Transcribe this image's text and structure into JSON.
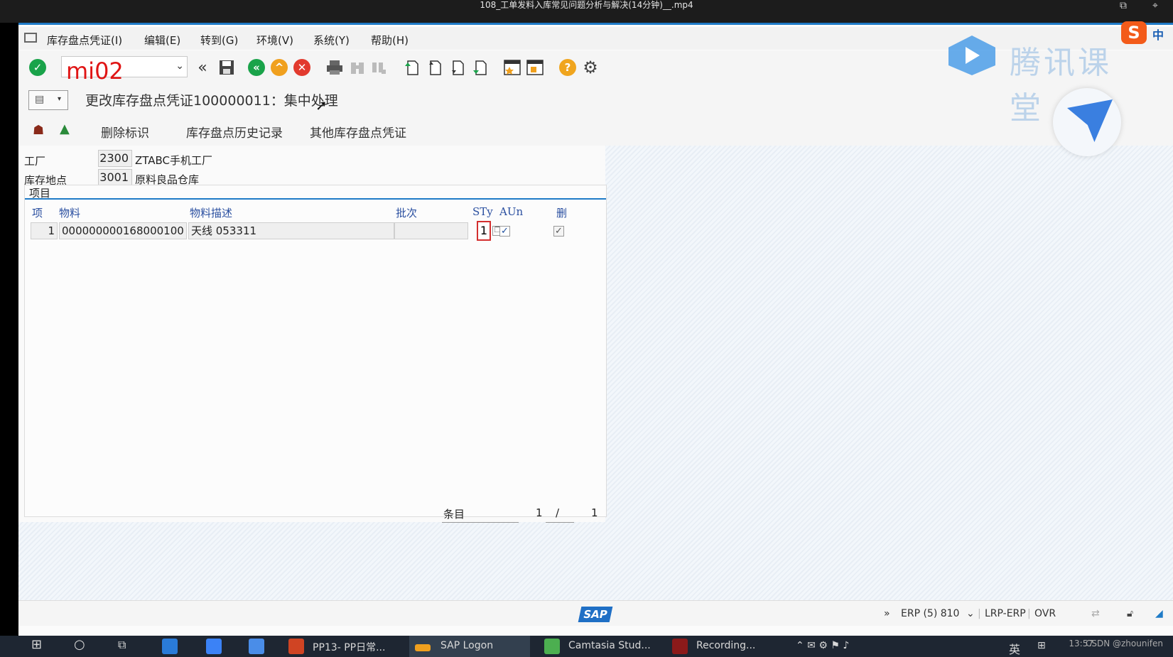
{
  "video": {
    "title": "108_工单发料入库常见问题分析与解决(14分钟)__.mp4"
  },
  "menu": [
    "库存盘点凭证(I)",
    "编辑(E)",
    "转到(G)",
    "环境(V)",
    "系统(Y)",
    "帮助(H)"
  ],
  "command": {
    "value": "mi02"
  },
  "screen": {
    "title": "更改库存盘点凭证100000011：集中处理"
  },
  "app_toolbar": {
    "delete_flag": "删除标识",
    "history": "库存盘点历史记录",
    "other": "其他库存盘点凭证"
  },
  "header": {
    "plant_label": "工厂",
    "plant_value": "2300",
    "plant_desc": "ZTABC手机工厂",
    "sloc_label": "库存地点",
    "sloc_value": "3001",
    "sloc_desc": "原料良品仓库"
  },
  "table": {
    "title": "项目",
    "columns": {
      "item": "项",
      "material": "物料",
      "desc": "物料描述",
      "batch": "批次",
      "sty": "STy",
      "aun": "AUn",
      "del": "删"
    },
    "rows": [
      {
        "item": "1",
        "material": "000000000168000100",
        "desc": "天线 053311",
        "batch": "",
        "sty": "1",
        "aun_checked": true,
        "del_checked": true
      }
    ],
    "footer": {
      "label": "条目",
      "current": "1",
      "sep": "/",
      "total": "1"
    }
  },
  "status": {
    "arrows": "»",
    "system": "ERP (5) 810",
    "server": "LRP-ERP",
    "mode": "OVR"
  },
  "watermark": {
    "brand": "腾讯课堂",
    "ime": "中",
    "credit": "CSDN @zhounifen"
  },
  "taskbar": {
    "apps": [
      "PP13- PP日常...",
      "SAP Logon",
      "Camtasia Stud...",
      "Recording..."
    ],
    "lang": "英",
    "time": "13:57"
  },
  "colors": {
    "accent": "#1f7bc7",
    "command_text": "#e01515",
    "column_header": "#2a4fa0"
  }
}
